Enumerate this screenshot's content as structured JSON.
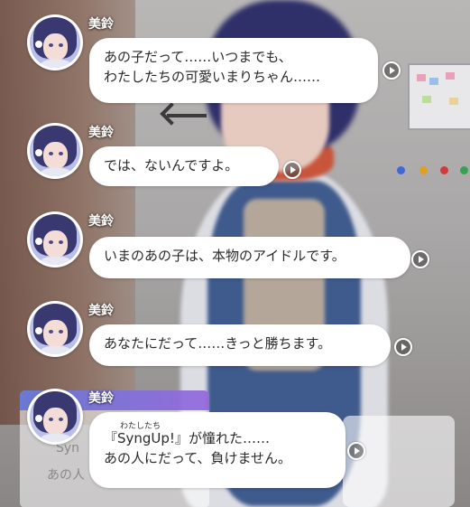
{
  "messages": [
    {
      "speaker": "美鈴",
      "lines": [
        "あの子だって……いつまでも、",
        "わたしたちの可愛いまりちゃん……"
      ]
    },
    {
      "speaker": "美鈴",
      "lines": [
        "では、ないんですよ。"
      ]
    },
    {
      "speaker": "美鈴",
      "lines": [
        "いまのあの子は、本物のアイドルです。"
      ]
    },
    {
      "speaker": "美鈴",
      "lines": [
        "あなたにだって……きっと勝ちます。"
      ]
    },
    {
      "speaker": "美鈴",
      "ruby": "わたしたち",
      "lines": [
        "『SyngUp!』が憧れた……",
        "あの人にだって、負けません。"
      ]
    }
  ],
  "background_text": {
    "panel_line1": "Syn",
    "panel_line2": "あの人"
  },
  "icons": {
    "voice": "play-circle-icon",
    "avatar": "character-portrait"
  },
  "colors": {
    "bubble": "#ffffff",
    "speaker_name": "#ffffff",
    "text": "#2a2a2a"
  }
}
